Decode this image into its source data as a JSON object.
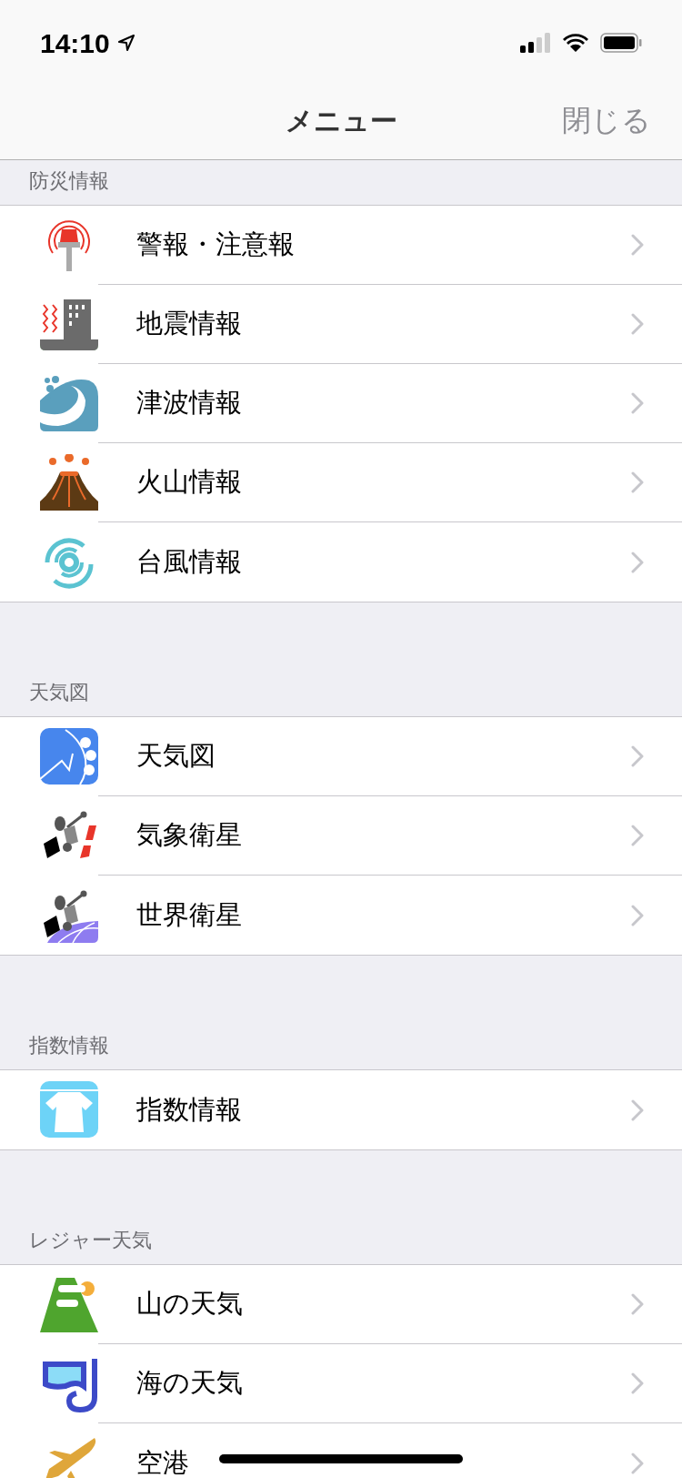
{
  "status_bar": {
    "time": "14:10"
  },
  "nav": {
    "title": "メニュー",
    "close": "閉じる"
  },
  "sections": [
    {
      "header": "防災情報",
      "items": [
        {
          "label": "警報・注意報"
        },
        {
          "label": "地震情報"
        },
        {
          "label": "津波情報"
        },
        {
          "label": "火山情報"
        },
        {
          "label": "台風情報"
        }
      ]
    },
    {
      "header": "天気図",
      "items": [
        {
          "label": "天気図"
        },
        {
          "label": "気象衛星"
        },
        {
          "label": "世界衛星"
        }
      ]
    },
    {
      "header": "指数情報",
      "items": [
        {
          "label": "指数情報"
        }
      ]
    },
    {
      "header": "レジャー天気",
      "items": [
        {
          "label": "山の天気"
        },
        {
          "label": "海の天気"
        },
        {
          "label": "空港"
        }
      ]
    }
  ]
}
